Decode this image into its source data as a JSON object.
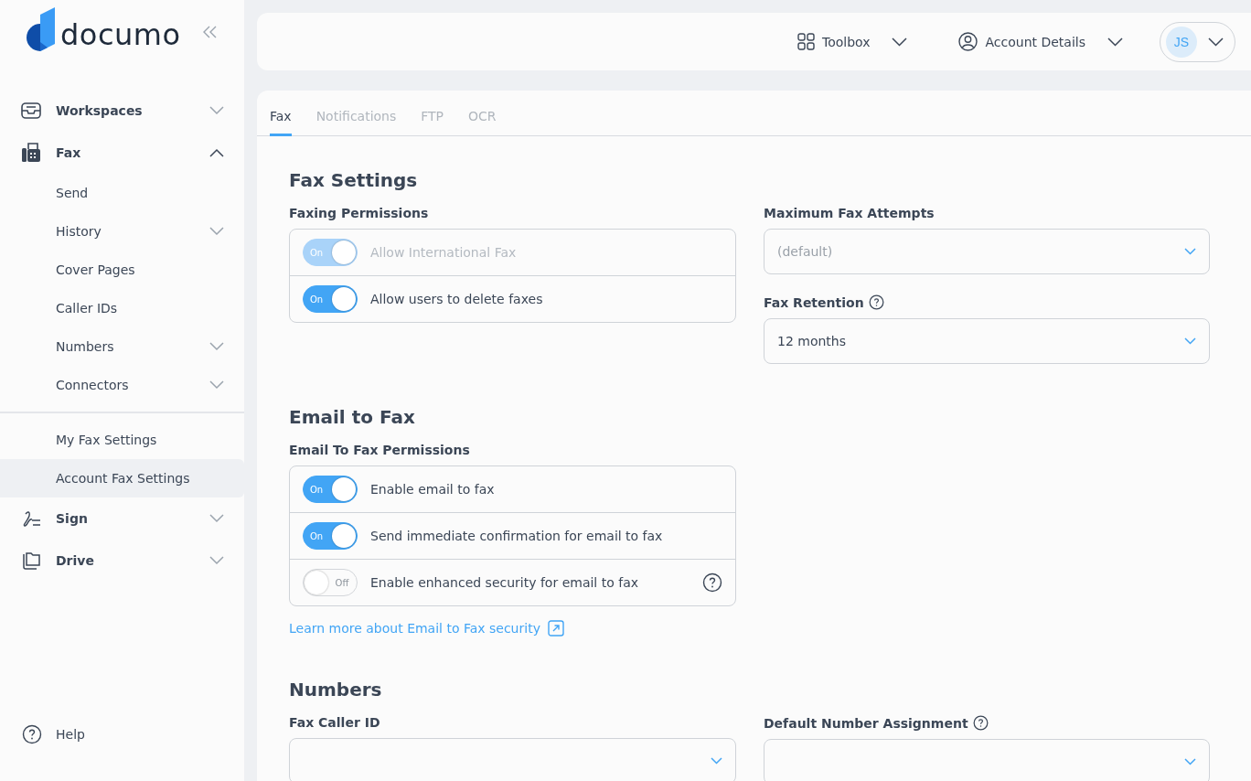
{
  "sidebar": {
    "logo": "documo",
    "nav": [
      {
        "label": "Workspaces",
        "expanded": false,
        "selected": false
      },
      {
        "label": "Fax",
        "expanded": true,
        "selected": false,
        "children": [
          {
            "kind": "link",
            "label": "Send",
            "selected": false
          },
          {
            "kind": "group",
            "label": "History",
            "expanded": false,
            "selected": false
          },
          {
            "kind": "link",
            "label": "Cover Pages",
            "selected": false
          },
          {
            "kind": "link",
            "label": "Caller IDs",
            "selected": false
          },
          {
            "kind": "group",
            "label": "Numbers",
            "expanded": false,
            "selected": false
          },
          {
            "kind": "group",
            "label": "Connectors",
            "expanded": false,
            "selected": false
          },
          {
            "kind": "divider"
          },
          {
            "kind": "link",
            "label": "My Fax Settings",
            "selected": false
          },
          {
            "kind": "link",
            "label": "Account Fax Settings",
            "selected": true
          }
        ]
      },
      {
        "label": "Sign",
        "expanded": false,
        "selected": false
      },
      {
        "label": "Drive",
        "expanded": false,
        "selected": false
      }
    ],
    "help": "Help"
  },
  "topbar": {
    "toolbox": "Toolbox",
    "account": "Account Details",
    "avatar": "JS"
  },
  "tabs": [
    {
      "label": "Fax",
      "selected": true
    },
    {
      "label": "Notifications",
      "selected": false
    },
    {
      "label": "FTP",
      "selected": false
    },
    {
      "label": "OCR",
      "selected": false
    }
  ],
  "sections": [
    {
      "title": "Fax Settings",
      "columns": [
        [
          {
            "kind": "toggles",
            "label": "Faxing Permissions",
            "toggles": [
              {
                "label": "Allow International Fax",
                "on": true,
                "disabled": true,
                "state_text": "On",
                "help": false
              },
              {
                "label": "Allow users to delete faxes",
                "on": true,
                "disabled": false,
                "state_text": "On",
                "help": false
              }
            ]
          }
        ],
        [
          {
            "kind": "select",
            "label": "Maximum Fax Attempts",
            "help": false,
            "placeholder": "(default)"
          },
          {
            "kind": "select",
            "label": "Fax Retention",
            "help": true,
            "value": "12 months"
          }
        ]
      ]
    },
    {
      "title": "Email to Fax",
      "columns": [
        [
          {
            "kind": "toggles",
            "label": "Email To Fax Permissions",
            "toggles": [
              {
                "label": "Enable email to fax",
                "on": true,
                "disabled": false,
                "state_text": "On",
                "help": false
              },
              {
                "label": "Send immediate confirmation for email to fax",
                "on": true,
                "disabled": false,
                "state_text": "On",
                "help": false
              },
              {
                "label": "Enable enhanced security for email to fax",
                "on": false,
                "disabled": false,
                "state_text": "Off",
                "help": true
              }
            ],
            "link": "Learn more about Email to Fax security"
          }
        ],
        []
      ]
    },
    {
      "title": "Numbers",
      "columns": [
        [
          {
            "kind": "select",
            "label": "Fax Caller ID",
            "help": false
          }
        ],
        [
          {
            "kind": "select",
            "label": "Default Number Assignment",
            "help": true
          }
        ]
      ]
    }
  ]
}
